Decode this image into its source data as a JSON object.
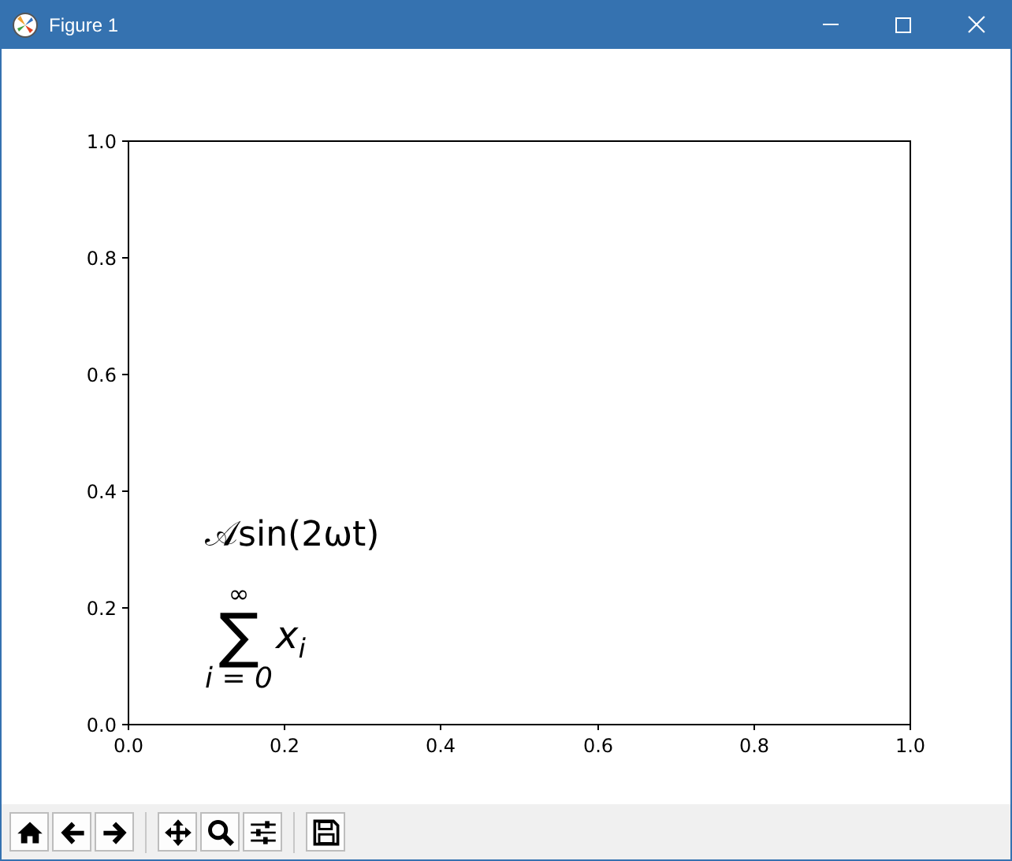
{
  "window": {
    "title": "Figure 1"
  },
  "figure": {
    "chart_data": {
      "type": "line",
      "xlim": [
        0,
        1
      ],
      "ylim": [
        0,
        1
      ],
      "xticks": [
        {
          "value": 0,
          "label": "0.0"
        },
        {
          "value": 0.2,
          "label": "0.2"
        },
        {
          "value": 0.4,
          "label": "0.4"
        },
        {
          "value": 0.6,
          "label": "0.6"
        },
        {
          "value": 0.8,
          "label": "0.8"
        },
        {
          "value": 1,
          "label": "1.0"
        }
      ],
      "yticks": [
        {
          "value": 0,
          "label": "0.0"
        },
        {
          "value": 0.2,
          "label": "0.2"
        },
        {
          "value": 0.4,
          "label": "0.4"
        },
        {
          "value": 0.6,
          "label": "0.6"
        },
        {
          "value": 0.8,
          "label": "0.8"
        },
        {
          "value": 1,
          "label": "1.0"
        }
      ]
    },
    "formulas": [
      {
        "kind": "text",
        "text": "𝒜sin(2ωt)"
      },
      {
        "kind": "sum",
        "upper": "∞",
        "symbol": "∑",
        "body": "x$_{i}$",
        "lower": "i = 0"
      }
    ]
  },
  "toolbar": {
    "groups": [
      {
        "buttons": [
          {
            "kind": "home"
          },
          {
            "kind": "back"
          },
          {
            "kind": "forward"
          }
        ]
      },
      {
        "buttons": [
          {
            "kind": "pan"
          },
          {
            "kind": "zoom"
          },
          {
            "kind": "configure"
          }
        ]
      },
      {
        "buttons": [
          {
            "kind": "save"
          }
        ]
      }
    ]
  }
}
